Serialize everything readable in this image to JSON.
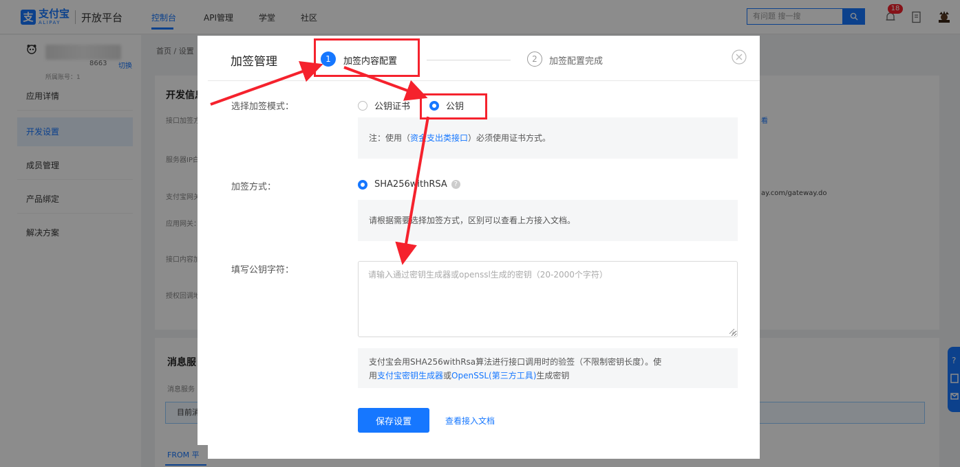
{
  "topnav": {
    "logo_mark": "支",
    "brand_cn": "支付宝",
    "brand_en": "ALIPAY",
    "platform": "开放平台",
    "items": [
      "控制台",
      "API管理",
      "学堂",
      "社区"
    ],
    "search_placeholder": "有问题 搜一搜",
    "notification_count": "18"
  },
  "sidebar": {
    "account_number": "8663",
    "account_switch": "切换",
    "account_sub": "所属账号：1",
    "items": [
      "应用详情",
      "开发设置",
      "成员管理",
      "产品绑定",
      "解决方案"
    ]
  },
  "background": {
    "breadcrumb": "首页 / 设置",
    "section_dev": "开发信息",
    "row_labels": [
      "接口加签方",
      "服务器IP白",
      "支付宝网关",
      "应用网关：",
      "接口内容加",
      "授权回调地"
    ],
    "gateway_suffix": "ay.com/gateway.do",
    "view_link": "看",
    "section_msg": "消息服",
    "msg_desc": "消息服务",
    "msg_input": "目前消",
    "tab_from": "FROM 平"
  },
  "modal": {
    "title": "加签管理",
    "step1_num": "1",
    "step1_label": "加签内容配置",
    "step2_num": "2",
    "step2_label": "加签配置完成",
    "mode_label": "选择加签模式：",
    "mode_options": [
      "公钥证书",
      "公钥"
    ],
    "mode_note_prefix": "注：使用（",
    "mode_note_link": "资金支出类接口",
    "mode_note_suffix": "）必须使用证书方式。",
    "method_label": "加签方式：",
    "method_option": "SHA256withRSA",
    "method_note": "请根据需要选择加签方式，区别可以查看上方接入文档。",
    "key_label": "填写公钥字符：",
    "key_placeholder": "请输入通过密钥生成器或openssl生成的密钥（20-2000个字符）",
    "key_value": "",
    "tip_line1": "支付宝会用SHA256withRsa算法进行接口调用时的验签（不限制密钥长度）。使",
    "tip_line2_prefix": "用",
    "tip_link1": "支付宝密钥生成器",
    "tip_or": "或",
    "tip_link2": "OpenSSL(第三方工具)",
    "tip_suffix": "生成密钥",
    "save_label": "保存设置",
    "docs_label": "查看接入文档"
  },
  "colors": {
    "accent": "#1677ff",
    "annotation": "#f5222d"
  }
}
